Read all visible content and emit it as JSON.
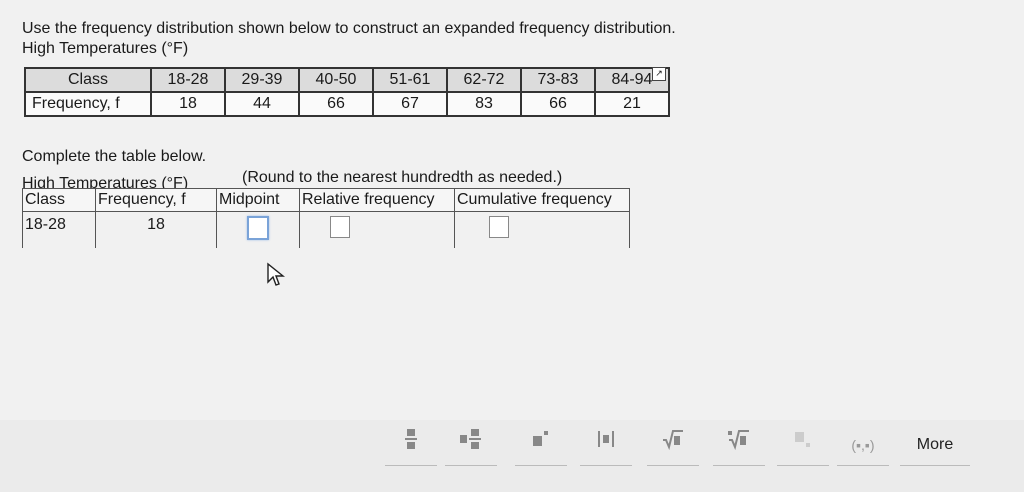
{
  "instruction": "Use the frequency distribution shown below to construct an expanded frequency distribution.",
  "given_table": {
    "title": "High Temperatures (°F)",
    "class_label": "Class",
    "frequency_label": "Frequency, f",
    "classes": [
      "18-28",
      "29-39",
      "40-50",
      "51-61",
      "62-72",
      "73-83",
      "84-94"
    ],
    "frequencies": [
      "18",
      "44",
      "66",
      "67",
      "83",
      "66",
      "21"
    ]
  },
  "complete_prompt": "Complete the table below.",
  "answer_table": {
    "title": "High Temperatures (°F)",
    "hint": "(Round to the nearest hundredth as needed.)",
    "headers": [
      "Class",
      "Frequency, f",
      "Midpoint",
      "Relative frequency",
      "Cumulative frequency"
    ],
    "row": {
      "class": "18-28",
      "frequency": "18"
    }
  },
  "toolbar": {
    "buttons": [
      "fraction-icon",
      "mixed-number-icon",
      "exponent-icon",
      "absolute-value-icon",
      "sqrt-icon",
      "nth-root-icon",
      "subscript-icon",
      "ordered-pair-icon"
    ],
    "ordered_pair_label": "(▪,▪)",
    "more_label": "More"
  }
}
